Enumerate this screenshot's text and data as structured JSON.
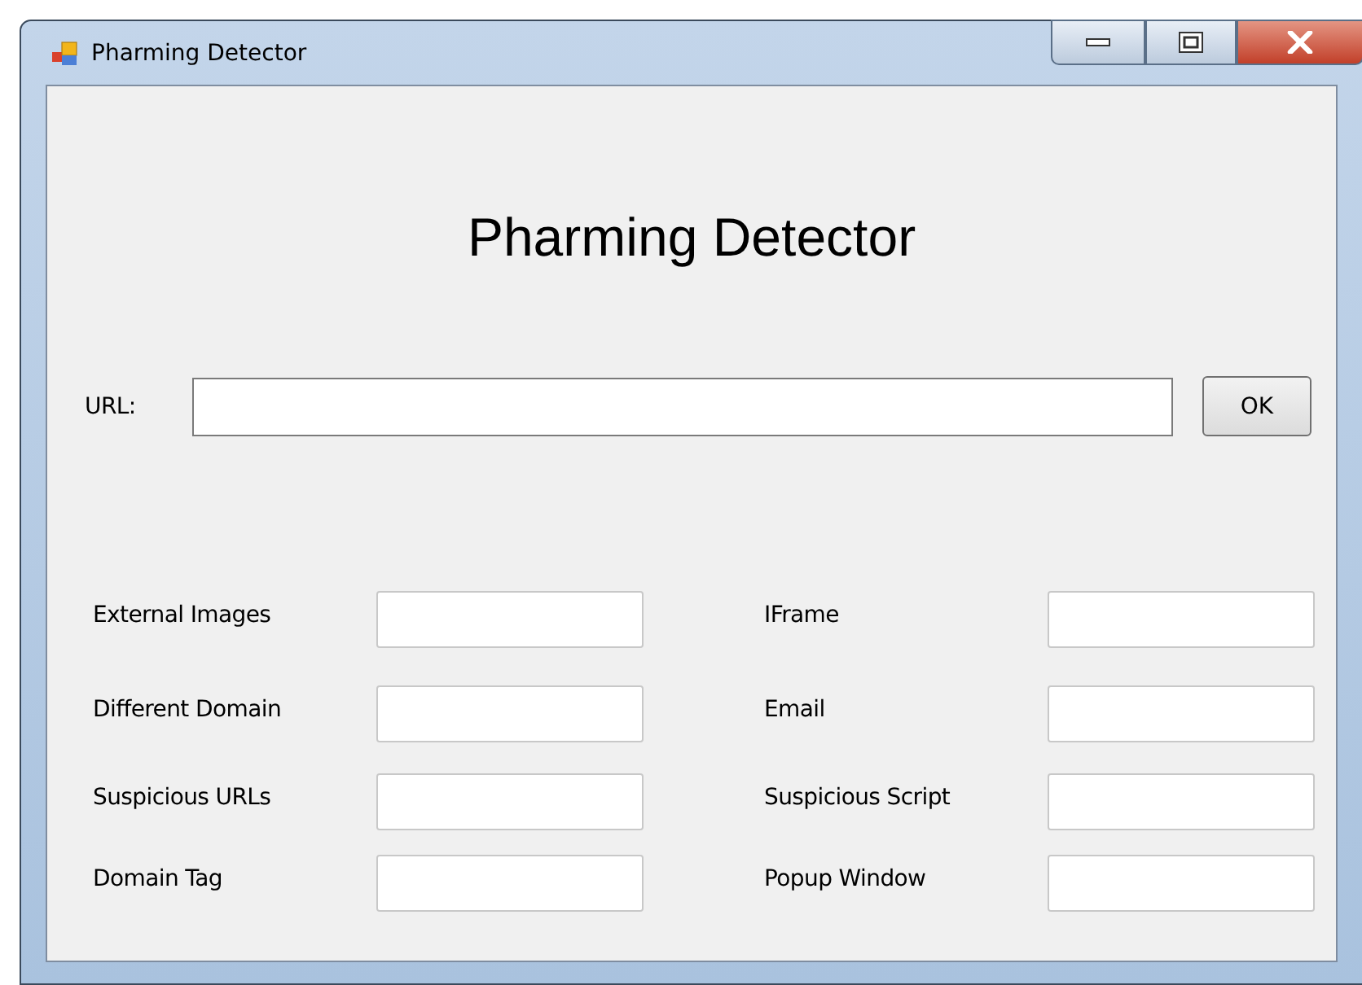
{
  "window": {
    "title": "Pharming Detector"
  },
  "heading": "Pharming Detector",
  "url": {
    "label": "URL:",
    "button": "OK"
  },
  "fields": [
    {
      "label": "External Images"
    },
    {
      "label": "IFrame"
    },
    {
      "label": "Different Domain"
    },
    {
      "label": "Email"
    },
    {
      "label": "Suspicious URLs"
    },
    {
      "label": "Suspicious Script"
    },
    {
      "label": "Domain Tag"
    },
    {
      "label": "Popup Window"
    }
  ]
}
